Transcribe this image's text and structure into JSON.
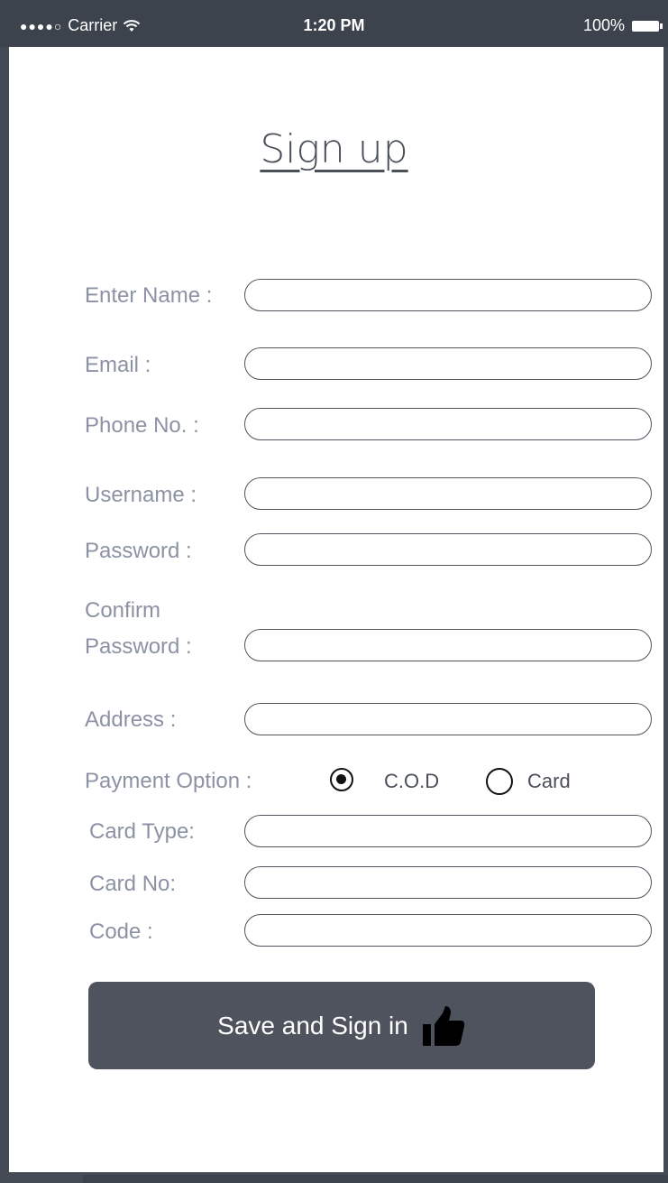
{
  "status_bar": {
    "signal": "●●●●○",
    "carrier": "Carrier",
    "time": "1:20 PM",
    "battery": "100%"
  },
  "title": "Sign up",
  "form": {
    "name_label": "Enter Name :",
    "email_label": "Email :",
    "phone_label": "Phone No. :",
    "username_label": "Username :",
    "password_label": "Password :",
    "confirm_label_1": "Confirm",
    "confirm_label_2": "Password :",
    "address_label": "Address :",
    "payment_label": "Payment Option :",
    "payment_options": [
      "C.O.D",
      "Card"
    ],
    "payment_selected": "C.O.D",
    "card_type_label": "Card Type:",
    "card_no_label": "Card No:",
    "code_label": "Code :"
  },
  "submit": {
    "label": "Save and Sign in",
    "icon": "thumbs-up-icon"
  },
  "colors": {
    "frame": "#454b55",
    "label_text": "#8b92a4",
    "button_bg": "#4e535d"
  }
}
